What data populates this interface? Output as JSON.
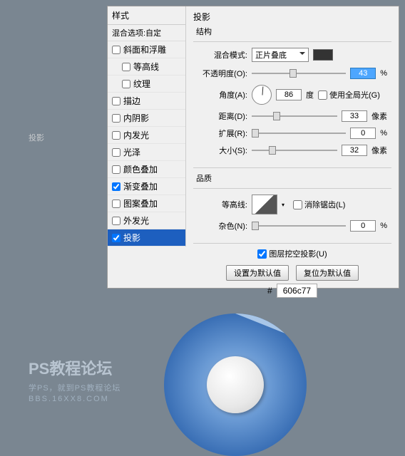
{
  "outside_label": "投影",
  "sidebar": {
    "header": "样式",
    "blend_options": "混合选项:自定",
    "items": [
      {
        "label": "斜面和浮雕",
        "checked": false
      },
      {
        "label": "等高线",
        "checked": false
      },
      {
        "label": "纹理",
        "checked": false
      },
      {
        "label": "描边",
        "checked": false
      },
      {
        "label": "内阴影",
        "checked": false
      },
      {
        "label": "内发光",
        "checked": false
      },
      {
        "label": "光泽",
        "checked": false
      },
      {
        "label": "颜色叠加",
        "checked": false
      },
      {
        "label": "渐变叠加",
        "checked": true
      },
      {
        "label": "图案叠加",
        "checked": false
      },
      {
        "label": "外发光",
        "checked": false
      },
      {
        "label": "投影",
        "checked": true,
        "selected": true
      }
    ]
  },
  "panel": {
    "title": "投影",
    "structure_label": "结构",
    "blend_mode_label": "混合模式:",
    "blend_mode_value": "正片叠底",
    "opacity_label": "不透明度(O):",
    "opacity_value": "43",
    "opacity_unit": "%",
    "angle_label": "角度(A):",
    "angle_value": "86",
    "angle_unit": "度",
    "global_light_label": "使用全局光(G)",
    "distance_label": "距离(D):",
    "distance_value": "33",
    "distance_unit": "像素",
    "spread_label": "扩展(R):",
    "spread_value": "0",
    "spread_unit": "%",
    "size_label": "大小(S):",
    "size_value": "32",
    "size_unit": "像素",
    "quality_label": "品质",
    "contour_label": "等高线:",
    "antialias_label": "消除锯齿(L)",
    "noise_label": "杂色(N):",
    "noise_value": "0",
    "noise_unit": "%",
    "knockout_label": "图层挖空投影(U)",
    "btn_default": "设置为默认值",
    "btn_reset": "复位为默认值"
  },
  "hex": {
    "symbol": "#",
    "value": "606c77"
  },
  "watermark": {
    "title": "PS教程论坛",
    "sub": "学PS，就到PS教程论坛",
    "url": "BBS.16XX8.COM"
  }
}
